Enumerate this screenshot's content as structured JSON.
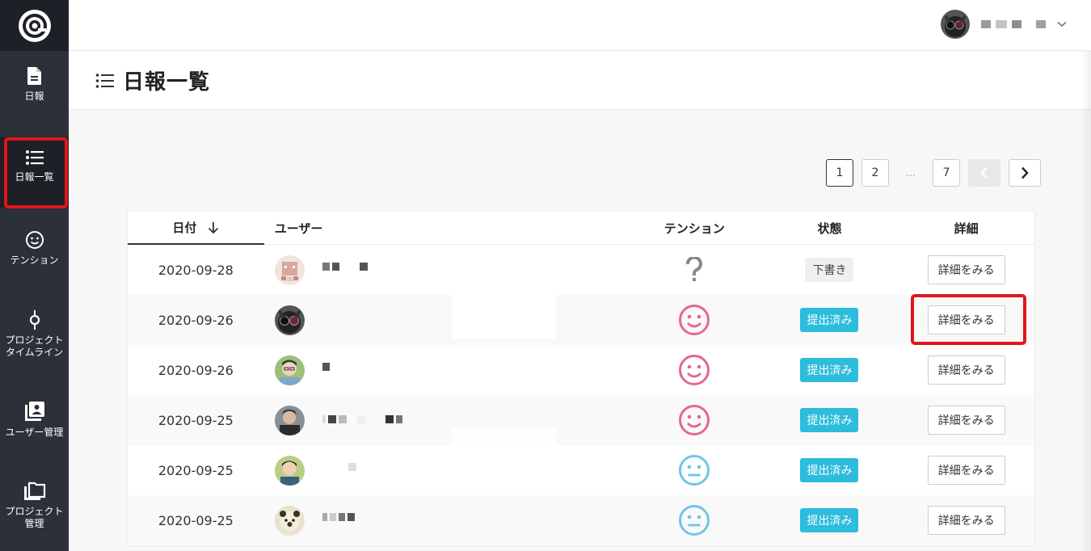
{
  "sidebar": {
    "items": [
      {
        "label": "日報",
        "icon": "document-icon"
      },
      {
        "label": "日報一覧",
        "icon": "list-icon"
      },
      {
        "label": "テンション",
        "icon": "smiley-icon"
      },
      {
        "label": "プロジェクト\nタイムライン",
        "icon": "timeline-node-icon"
      },
      {
        "label": "ユーザー管理",
        "icon": "user-book-icon"
      },
      {
        "label": "プロジェクト\n管理",
        "icon": "folders-icon"
      }
    ]
  },
  "page": {
    "title": "日報一覧"
  },
  "pagination": {
    "pages": [
      "1",
      "2",
      "7"
    ],
    "ellipsis": "...",
    "current": "1"
  },
  "table": {
    "headers": {
      "date": "日付",
      "user": "ユーザー",
      "tension": "テンション",
      "status": "状態",
      "detail": "詳細"
    },
    "rows": [
      {
        "date": "2020-09-28",
        "tension": "unknown",
        "status": "下書き",
        "detail": "詳細をみる"
      },
      {
        "date": "2020-09-26",
        "tension": "happy",
        "status": "提出済み",
        "detail": "詳細をみる"
      },
      {
        "date": "2020-09-26",
        "tension": "happy",
        "status": "提出済み",
        "detail": "詳細をみる"
      },
      {
        "date": "2020-09-25",
        "tension": "happy",
        "status": "提出済み",
        "detail": "詳細をみる"
      },
      {
        "date": "2020-09-25",
        "tension": "neutral",
        "status": "提出済み",
        "detail": "詳細をみる"
      },
      {
        "date": "2020-09-25",
        "tension": "neutral",
        "status": "提出済み",
        "detail": "詳細をみる"
      }
    ]
  },
  "colors": {
    "sidebar": "#2c3038",
    "accent_badge": "#2cbcdc",
    "happy": "#e8658e",
    "neutral": "#6ec6e6",
    "highlight": "#e0161b"
  }
}
